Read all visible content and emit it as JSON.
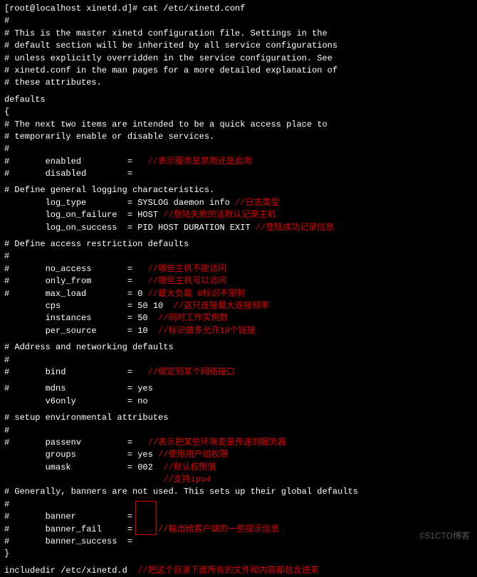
{
  "prompt": "[root@localhost xinetd.d]# cat /etc/xinetd.conf",
  "l1": "#",
  "l2": "# This is the master xinetd configuration file. Settings in the",
  "l3": "# default section will be inherited by all service configurations",
  "l4": "# unless explicitly overridden in the service configuration. See",
  "l5": "# xinetd.conf in the man pages for a more detailed explanation of",
  "l6": "# these attributes.",
  "l7": "defaults",
  "l8": "{",
  "l9": "# The next two items are intended to be a quick access place to",
  "l10": "# temporarily enable or disable services.",
  "l11": "#",
  "enabled": "#       enabled         =",
  "enabled_ann": "//表示服务是禁用还是启用",
  "disabled": "#       disabled        =",
  "log_header": "# Define general logging characteristics.",
  "log_type": "        log_type        = SYSLOG daemon info ",
  "log_type_ann": "//日志类型",
  "log_fail": "        log_on_failure  = HOST ",
  "log_fail_ann": "//登陆失败的话默认记录主机",
  "log_succ": "        log_on_success  = PID HOST DURATION EXIT",
  "log_succ_ann": " //登陆成功记录信息",
  "access_header": "# Define access restriction defaults",
  "no_access": "#       no_access       =",
  "no_access_ann": "//哪些主机不能访问",
  "only_from": "#       only_from       =",
  "only_from_ann": "//哪些主机可以访问",
  "max_load": "#       max_load        = 0 ",
  "max_load_ann": "//最大负载 0标识不限制",
  "cps": "        cps             = 50 10  ",
  "cps_ann": "//这只连接最大连接频率",
  "instances": "        instances       = 50  ",
  "instances_ann": "//同时工作实例数",
  "per_source": "        per_source      = 10  ",
  "per_source_ann": "//标识做多允许10个链接",
  "net_header": "# Address and networking defaults",
  "bind": "#       bind            =",
  "bind_ann": "//绑定到某个网络接口",
  "mdns": "#       mdns            = yes",
  "v6only": "        v6only          = no",
  "env_header": "# setup environmental attributes",
  "passenv": "#       passenv         =",
  "passenv_ann": "//表示把某些环境变量传递到服务器",
  "groups": "        groups          = yes ",
  "groups_ann": "//使用用户组权限",
  "umask": "        umask           = 002  ",
  "umask_ann": "//默认权限值",
  "v4_ann": "                               //支持ipv4",
  "banner_header": "# Generally, banners are not used. This sets up their global defaults",
  "banner": "#       banner          =",
  "banner_fail": "#       banner_fail     =",
  "banner_ann": "//输出给客户端的一些提示信息",
  "banner_success": "#       banner_success  =",
  "brace": "}",
  "include": "includedir /etc/xinetd.d  ",
  "include_ann": "//把这个目录下面所有的文件和内容都包含进来",
  "watermark": "©51CTO博客"
}
